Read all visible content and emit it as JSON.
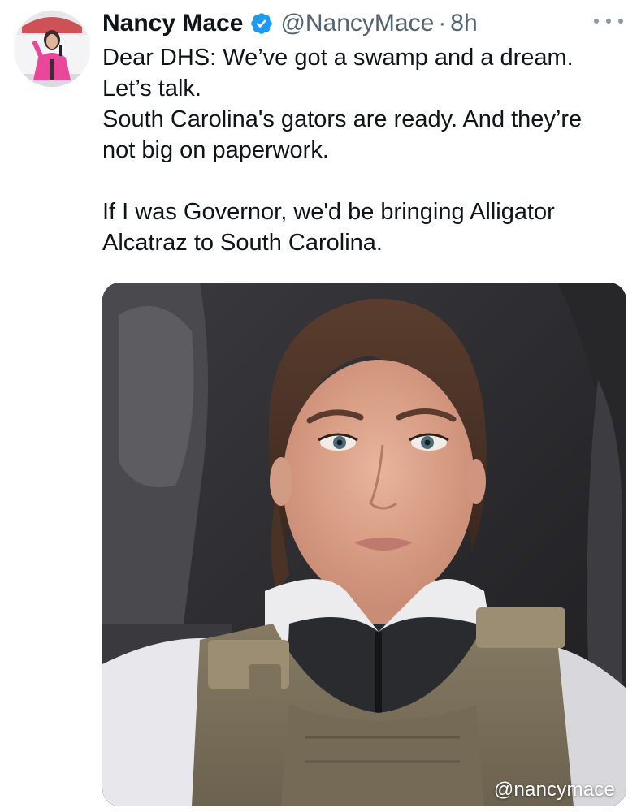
{
  "tweet": {
    "author": {
      "display_name": "Nancy Mace",
      "handle": "@NancyMace",
      "verified": true,
      "verified_color": "#1d9bf0"
    },
    "separator": "·",
    "time": "8h",
    "text_lines": [
      "Dear DHS: We’ve got a swamp and a dream.",
      "Let’s talk.",
      "South Carolina's gators are ready. And they’re",
      "not big on paperwork."
    ],
    "text_lines_2": [
      "If I was Governor, we'd be bringing Alligator",
      "Alcatraz to South Carolina."
    ],
    "media": {
      "watermark": "@nancymace",
      "description_icon": "photo"
    },
    "more_icon": "more-horizontal-icon"
  }
}
